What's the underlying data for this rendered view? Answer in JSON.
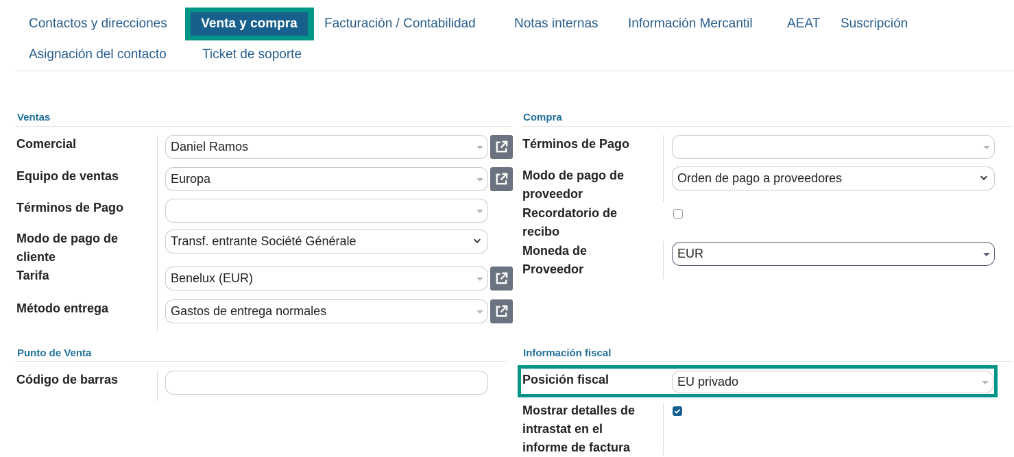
{
  "tabs": [
    {
      "label": "Contactos y direcciones"
    },
    {
      "label": "Venta y compra",
      "active": true
    },
    {
      "label": "Facturación / Contabilidad"
    },
    {
      "label": "Notas internas"
    },
    {
      "label": "Información Mercantil"
    },
    {
      "label": "AEAT"
    },
    {
      "label": "Suscripción"
    },
    {
      "label": "Asignación del contacto"
    },
    {
      "label": "Ticket de soporte"
    }
  ],
  "ventas": {
    "title": "Ventas",
    "comercial": {
      "label": "Comercial",
      "value": "Daniel Ramos"
    },
    "equipo": {
      "label": "Equipo de ventas",
      "value": "Europa"
    },
    "terminos": {
      "label": "Términos de Pago",
      "value": ""
    },
    "modo_pago": {
      "label_line1": "Modo de pago de",
      "label_line2": "cliente",
      "value": "Transf. entrante Société Générale"
    },
    "tarifa": {
      "label": "Tarifa",
      "value": "Benelux (EUR)"
    },
    "metodo_entrega": {
      "label": "Método entrega",
      "value": "Gastos de entrega normales"
    }
  },
  "compra": {
    "title": "Compra",
    "terminos": {
      "label": "Términos de Pago",
      "value": ""
    },
    "modo_pago": {
      "label_line1": "Modo de pago de",
      "label_line2": "proveedor",
      "value": "Orden de pago a proveedores"
    },
    "recordatorio": {
      "label_line1": "Recordatorio de",
      "label_line2": "recibo",
      "checked": false
    },
    "moneda": {
      "label_line1": "Moneda de",
      "label_line2": "Proveedor",
      "value": "EUR"
    }
  },
  "punto_venta": {
    "title": "Punto de Venta",
    "codigo_barras": {
      "label": "Código de barras",
      "value": ""
    }
  },
  "info_fiscal": {
    "title": "Información fiscal",
    "posicion": {
      "label": "Posición fiscal",
      "value": "EU privado"
    },
    "intrastat": {
      "label_line1": "Mostrar detalles de",
      "label_line2": "intrastat en el",
      "label_line3": "informe de factura",
      "checked": true
    }
  },
  "colors": {
    "accent": "#17608d",
    "highlight": "#019588",
    "tab_text": "#285d8c",
    "section_title": "#1f6f9a"
  },
  "icons": {
    "external_link": "external-link-icon",
    "dropdown": "caret-down-icon",
    "chevron": "chevron-down-icon",
    "check": "check-icon"
  }
}
